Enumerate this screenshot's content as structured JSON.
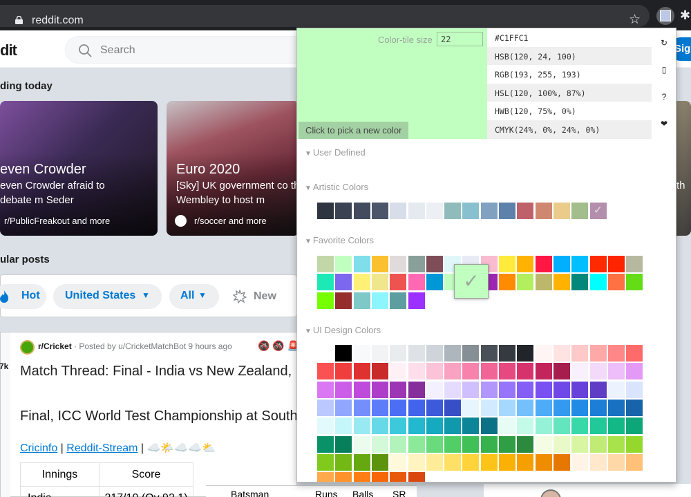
{
  "browser": {
    "url": "reddit.com",
    "star_icon": "☆",
    "puzzle_icon": "✱"
  },
  "reddit": {
    "logo": "dit",
    "search_placeholder": "Search",
    "signup_label": "Sig",
    "trending_title": "ding today",
    "cards": [
      {
        "title": "even Crowder",
        "desc": "even Crowder afraid to debate m Seder",
        "sub": "r/PublicFreakout and more"
      },
      {
        "title": "Euro 2020",
        "desc": "[Sky] UK government co that Wembley to host m",
        "sub": "r/soccer and more"
      },
      {
        "title": "",
        "desc": "es th",
        "sub": ""
      }
    ],
    "popular_title": "ular posts",
    "sort": {
      "hot": "Hot",
      "region": "United States",
      "all": "All",
      "new": "New"
    },
    "post": {
      "votes": "7k",
      "subreddit": "r/Cricket",
      "meta": " · Posted by u/CricketMatchBot 9 hours ago",
      "awards": "🚳 🚳 🚨",
      "title": "Match Thread: Final - India vs New Zealand,",
      "body": "Final, ICC World Test Championship at South",
      "link1": "Cricinfo",
      "sep": " | ",
      "link2": "Reddit-Stream",
      "weather": " | ☁️🌤️☁️☁️⛅",
      "table_headers": [
        "Innings",
        "Score"
      ],
      "table_row": [
        "India",
        "217/10 (Ov 92.1)"
      ],
      "bat_headers": [
        "Batsman",
        "Runs",
        "Balls",
        "SR"
      ]
    }
  },
  "picker": {
    "color": "#C1FFC1",
    "tile_label": "Color-tile size",
    "tile_size": "22",
    "pick_label": "Click to pick a new color",
    "codes": [
      "#C1FFC1",
      "HSB(120, 24, 100)",
      "RGB(193, 255, 193)",
      "HSL(120, 100%, 87%)",
      "HWB(120, 75%, 0%)",
      "CMYK(24%, 0%, 24%, 0%)"
    ],
    "tools": [
      {
        "icon": "refresh-icon",
        "glyph": "↻"
      },
      {
        "icon": "phone-icon",
        "glyph": "▯"
      },
      {
        "icon": "help-icon",
        "glyph": "?"
      },
      {
        "icon": "heart-icon",
        "glyph": "❤"
      }
    ],
    "sections": {
      "user_defined": "User Defined",
      "artistic": "Artistic Colors",
      "favorite": "Favorite Colors",
      "ui_design": "UI Design Colors"
    },
    "artistic_colors": [
      "#2e3440",
      "#3b4252",
      "#434c5e",
      "#4c566a",
      "#d8dee9",
      "#e5e9f0",
      "#eceff4",
      "#8fbcbb",
      "#88c0d0",
      "#81a1c1",
      "#5e81ac",
      "#bf616a",
      "#d08770",
      "#ebcb8b",
      "#a3be8c",
      "#b48ead"
    ],
    "artistic_checked_index": 15,
    "favorite_colors": [
      "#c2d7a7",
      "#c1ffc1",
      "#80deea",
      "#fbc02d",
      "#e0dada",
      "#88a099",
      "#7e4d58",
      "#e0f7fa",
      "#e8eaf6",
      "#f8bbd0",
      "#ffeb3b",
      "#ffb300",
      "#ff1744",
      "#00b0ff",
      "#00bfff",
      "#ff2a00",
      "#ff2400",
      "#b7b8a0",
      "#1de9b6",
      "#7b68ee",
      "#fff176",
      "#f0e68c",
      "#ef5350",
      "#ff69b4",
      "#0097d7",
      "#c1ffc1",
      "#c1ffc1",
      "#9c27b0",
      "#ff8c00",
      "#b2ee5e",
      "#bdb76b",
      "#ffb300",
      "#00897b",
      "#00ffff",
      "#ff7043",
      "#64dd17",
      "#76ff03",
      "#962d2d",
      "#7ec8c8",
      "#8cf5ff",
      "#5f9ea0",
      "#9b30ff"
    ],
    "ui_colors": [
      "#ffffff",
      "#000000",
      "#f8f9fa",
      "#f1f3f5",
      "#e9ecef",
      "#dee2e6",
      "#ced4da",
      "#adb5bd",
      "#868e96",
      "#495057",
      "#343a40",
      "#212529",
      "#fff5f5",
      "#ffe3e3",
      "#ffc9c9",
      "#ffa8a8",
      "#ff8787",
      "#ff6b6b",
      "#fa5252",
      "#f03e3e",
      "#e03131",
      "#c92a2a",
      "#fff0f6",
      "#ffdeeb",
      "#fcc2d7",
      "#faa2c1",
      "#f783ac",
      "#f06595",
      "#e64980",
      "#d6336c",
      "#c2255c",
      "#a61e4d",
      "#f8f0fc",
      "#f3d9fa",
      "#eebefa",
      "#e599f7",
      "#da77f2",
      "#cc5de8",
      "#be4bdb",
      "#ae3ec9",
      "#9c36b5",
      "#862e9c",
      "#f3f0ff",
      "#e5dbff",
      "#d0bfff",
      "#b197fc",
      "#9775fa",
      "#845ef7",
      "#7950f2",
      "#7048e8",
      "#6741d9",
      "#5f3dc4",
      "#edf2ff",
      "#dbe4ff",
      "#bac8ff",
      "#91a7ff",
      "#748ffc",
      "#5c7cfa",
      "#4c6ef5",
      "#4263eb",
      "#3b5bdb",
      "#364fc7",
      "#e7f5ff",
      "#d0ebff",
      "#a5d8ff",
      "#74c0fc",
      "#4dabf7",
      "#339af0",
      "#228be6",
      "#1c7ed6",
      "#1971c2",
      "#1864ab",
      "#e3fafc",
      "#c5f6fa",
      "#99e9f2",
      "#66d9e8",
      "#3bc9db",
      "#22b8cf",
      "#15aabf",
      "#1098ad",
      "#0c8599",
      "#0b7285",
      "#e6fcf5",
      "#c3fae8",
      "#96f2d7",
      "#63e6be",
      "#38d9a9",
      "#20c997",
      "#12b886",
      "#0ca678",
      "#099268",
      "#087f5b",
      "#ebfbee",
      "#d3f9d8",
      "#b2f2bb",
      "#8ce99a",
      "#69db7c",
      "#51cf66",
      "#40c057",
      "#37b24d",
      "#2f9e44",
      "#2b8a3e",
      "#f4fce3",
      "#e9fac8",
      "#d8f5a2",
      "#c0eb75",
      "#a9e34b",
      "#94d82d",
      "#82c91e",
      "#74b816",
      "#66a80f",
      "#5c940d",
      "#fff9db",
      "#fff3bf",
      "#ffec99",
      "#ffe066",
      "#ffd43b",
      "#fcc419",
      "#fab005",
      "#f59f00",
      "#f08c00",
      "#e67700",
      "#fff4e6",
      "#ffe8cc",
      "#ffd8a8",
      "#ffc078",
      "#ffa94d",
      "#ff922b",
      "#fd7e14",
      "#f76707",
      "#e8590c",
      "#d9480f"
    ]
  }
}
